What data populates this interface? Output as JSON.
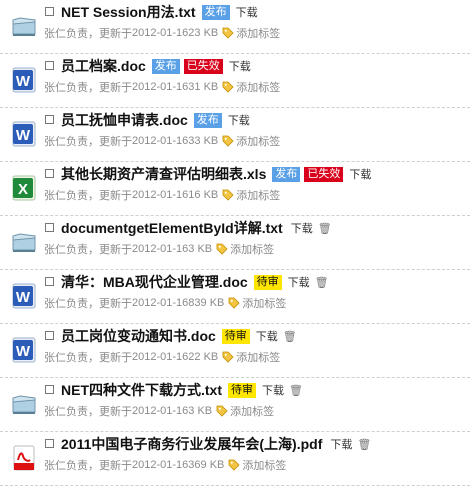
{
  "labels": {
    "owner_suffix": " 负责，更新于 ",
    "add_tag": "添加标签",
    "download": "下载",
    "trash_glyph": "🗑"
  },
  "files": [
    {
      "type": "txt",
      "title": "NET Session用法.txt",
      "owner": "张仁",
      "date": "2012-01-16",
      "size": "23 KB",
      "badges": [
        {
          "kind": "pub",
          "text": "发布"
        }
      ],
      "trash": false
    },
    {
      "type": "doc",
      "title": "员工档案.doc",
      "owner": "张仁",
      "date": "2012-01-16",
      "size": "31 KB",
      "badges": [
        {
          "kind": "pub",
          "text": "发布"
        },
        {
          "kind": "exp",
          "text": "已失效"
        }
      ],
      "trash": false
    },
    {
      "type": "doc",
      "title": "员工抚恤申请表.doc",
      "owner": "张仁",
      "date": "2012-01-16",
      "size": "33 KB",
      "badges": [
        {
          "kind": "pub",
          "text": "发布"
        }
      ],
      "trash": false
    },
    {
      "type": "xls",
      "title": "其他长期资产清查评估明细表.xls",
      "owner": "张仁",
      "date": "2012-01-16",
      "size": "16 KB",
      "badges": [
        {
          "kind": "pub",
          "text": "发布"
        },
        {
          "kind": "exp",
          "text": "已失效"
        }
      ],
      "trash": false
    },
    {
      "type": "txt",
      "title": "documentgetElementById详解.txt",
      "owner": "张仁",
      "date": "2012-01-16",
      "size": "3 KB",
      "badges": [],
      "trash": true
    },
    {
      "type": "doc",
      "title": "清华：MBA现代企业管理.doc",
      "owner": "张仁",
      "date": "2012-01-16",
      "size": "839 KB",
      "badges": [
        {
          "kind": "pend",
          "text": "待审"
        }
      ],
      "trash": true
    },
    {
      "type": "doc",
      "title": "员工岗位变动通知书.doc",
      "owner": "张仁",
      "date": "2012-01-16",
      "size": "22 KB",
      "badges": [
        {
          "kind": "pend",
          "text": "待审"
        }
      ],
      "trash": true
    },
    {
      "type": "txt",
      "title": "NET四种文件下载方式.txt",
      "owner": "张仁",
      "date": "2012-01-16",
      "size": "3 KB",
      "badges": [
        {
          "kind": "pend",
          "text": "待审"
        }
      ],
      "trash": true
    },
    {
      "type": "pdf",
      "title": "2011中国电子商务行业发展年会(上海).pdf",
      "owner": "张仁",
      "date": "2012-01-16",
      "size": "369 KB",
      "badges": [],
      "trash": true
    }
  ]
}
